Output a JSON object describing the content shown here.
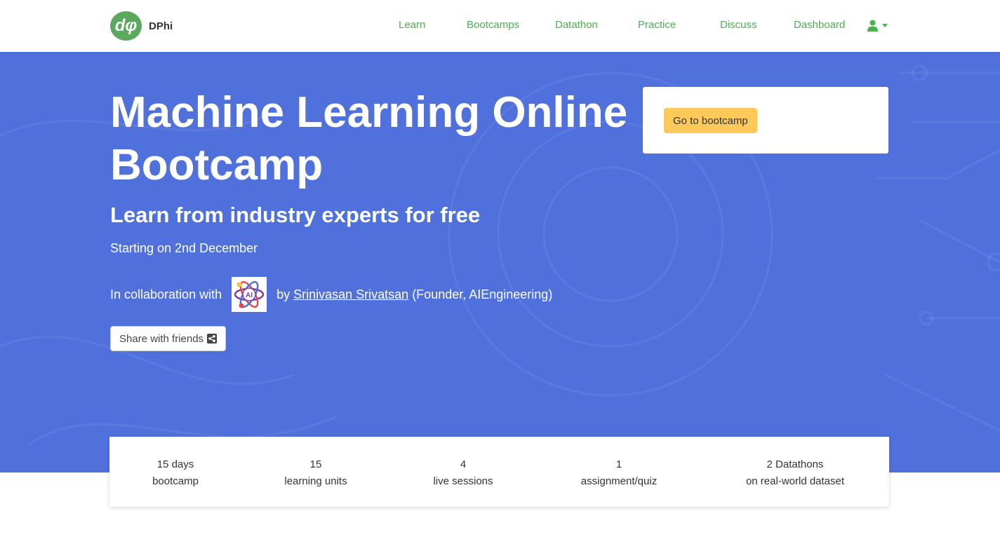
{
  "brand": {
    "name": "DPhi",
    "logo_mark": "dφ"
  },
  "nav": {
    "items": [
      {
        "label": "Learn"
      },
      {
        "label": "Bootcamps"
      },
      {
        "label": "Datathon"
      },
      {
        "label": "Practice"
      },
      {
        "label": "Discuss"
      },
      {
        "label": "Dashboard"
      }
    ],
    "user_icon": "user-icon",
    "accent_color": "#4caf50"
  },
  "hero": {
    "title": "Machine Learning Online Bootcamp",
    "subtitle": "Learn from industry experts for free",
    "start_date": "Starting on 2nd December",
    "collab_prefix": "In collaboration with",
    "partner_logo_text": "AI",
    "by_prefix": "by",
    "author": "Srinivasan Srivatsan",
    "author_suffix": "(Founder, AIEngineering)",
    "share_label": "Share with friends",
    "share_icon": "share-icon",
    "background_color": "#5070dc"
  },
  "cta": {
    "button_label": "Go to bootcamp",
    "button_color": "#fdc959"
  },
  "stats": [
    {
      "value": "15 days",
      "label": "bootcamp"
    },
    {
      "value": "15",
      "label": "learning units"
    },
    {
      "value": "4",
      "label": "live sessions"
    },
    {
      "value": "1",
      "label": "assignment/quiz"
    },
    {
      "value": "2 Datathons",
      "label": "on real-world dataset"
    }
  ]
}
